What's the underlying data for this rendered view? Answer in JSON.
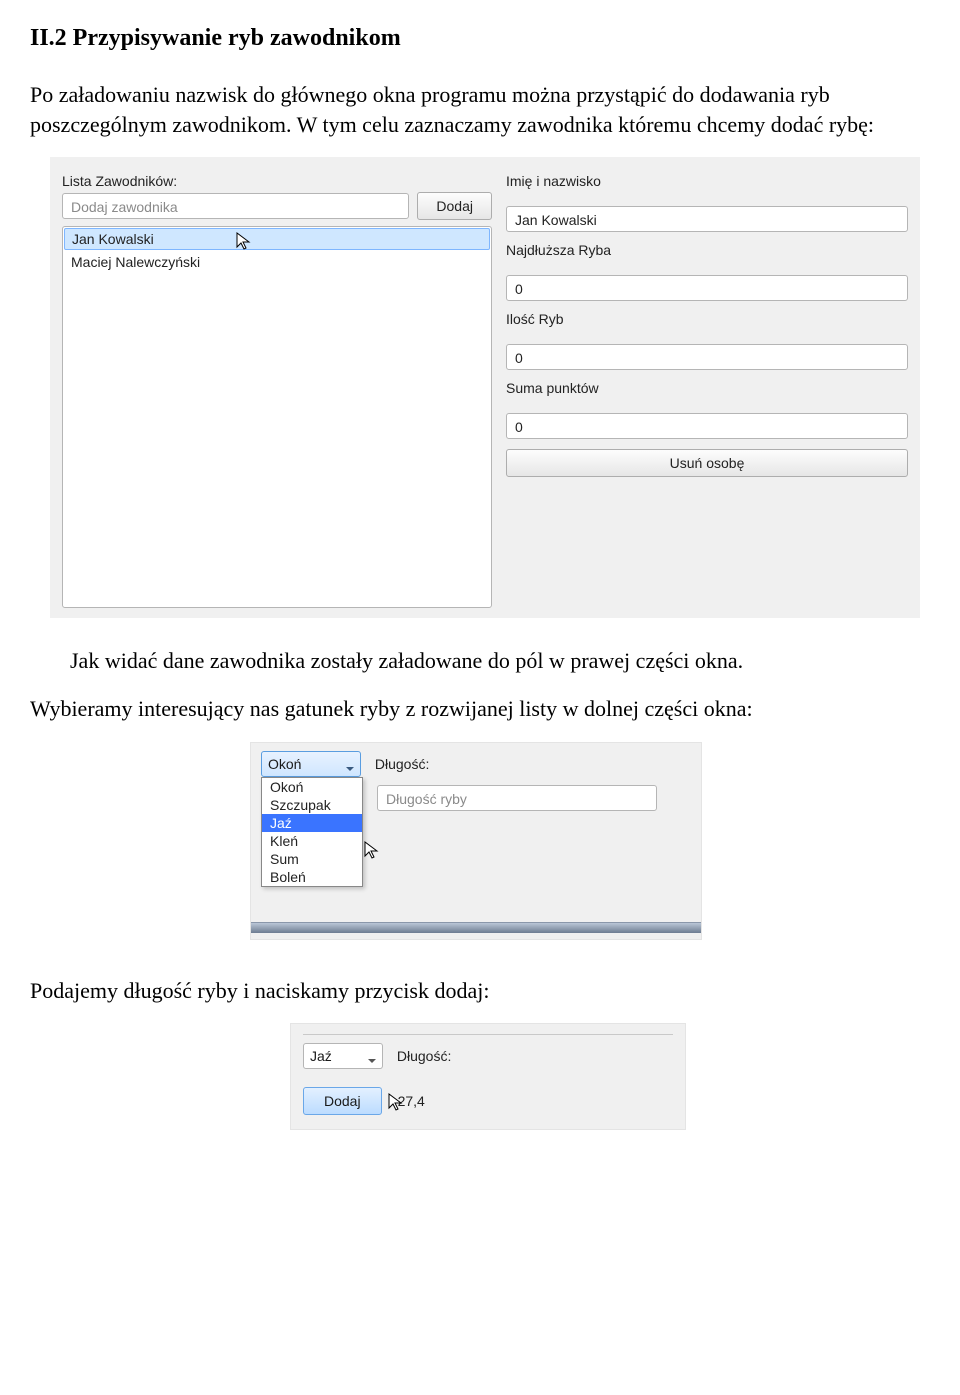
{
  "heading": "II.2 Przypisywanie ryb zawodnikom",
  "para1": "Po załadowaniu nazwisk do głównego okna programu można przystąpić do dodawania ryb poszczególnym zawodnikom. W tym celu zaznaczamy zawodnika któremu chcemy dodać rybę:",
  "para2": "Jak widać dane zawodnika zostały załadowane do pól w prawej części okna.",
  "para3": "Wybieramy interesujący nas gatunek ryby z rozwijanej listy w dolnej części okna:",
  "para4": "Podajemy długość ryby i naciskamy przycisk dodaj:",
  "shot1": {
    "list_label": "Lista Zawodników:",
    "add_placeholder": "Dodaj zawodnika",
    "add_button": "Dodaj",
    "list": [
      "Jan Kowalski",
      "Maciej Nalewczyński"
    ],
    "right": {
      "name_label": "Imię i nazwisko",
      "name_value": "Jan Kowalski",
      "longest_label": "Najdłuższa Ryba",
      "longest_value": "0",
      "count_label": "Ilość Ryb",
      "count_value": "0",
      "points_label": "Suma punktów",
      "points_value": "0",
      "delete_button": "Usuń osobę"
    }
  },
  "shot2": {
    "combo_value": "Okoń",
    "length_label": "Długość:",
    "length_placeholder": "Długość ryby",
    "options": [
      "Okoń",
      "Szczupak",
      "Jaź",
      "Kleń",
      "Sum",
      "Boleń"
    ],
    "highlight": "Jaź"
  },
  "shot3": {
    "combo_value": "Jaź",
    "length_label": "Długość:",
    "add_button": "Dodaj",
    "length_value": "27,4"
  }
}
